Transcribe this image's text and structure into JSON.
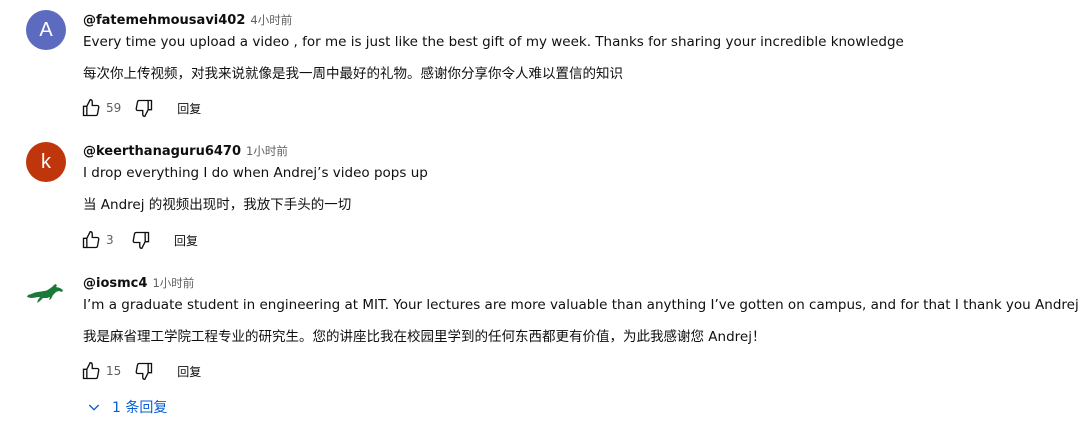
{
  "comments": [
    {
      "handle": "@fatemehmousavi402",
      "time": "4小时前",
      "avatar_letter": "A",
      "avatar_color": "#5c6bc0",
      "text_en": "Every time you upload a video , for me is just like the best gift of my week. Thanks for sharing your incredible knowledge",
      "text_zh": "每次你上传视频，对我来说就像是我一周中最好的礼物。感谢你分享你令人难以置信的知识",
      "likes": "59",
      "reply_label": "回复"
    },
    {
      "handle": "@keerthanaguru6470",
      "time": "1小时前",
      "avatar_letter": "k",
      "avatar_color": "#bf360c",
      "text_en": "I drop everything I do when Andrej’s video pops up",
      "text_zh": "当 Andrej 的视频出现时，我放下手头的一切",
      "likes": "3",
      "reply_label": "回复"
    },
    {
      "handle": "@iosmc4",
      "time": "1小时前",
      "avatar_color": "#1b7a3a",
      "text_en": "I’m a graduate student in engineering at MIT. Your lectures are more valuable than anything I’ve gotten on campus, and for that I thank you Andrej!",
      "text_zh": "我是麻省理工学院工程专业的研究生。您的讲座比我在校园里学到的任何东西都更有价值，为此我感谢您 Andrej！",
      "likes": "15",
      "reply_label": "回复"
    }
  ],
  "replies_toggle": "1 条回复",
  "icons": {
    "like": "thumbs-up-icon",
    "dislike": "thumbs-down-icon",
    "expand": "chevron-down-icon"
  }
}
